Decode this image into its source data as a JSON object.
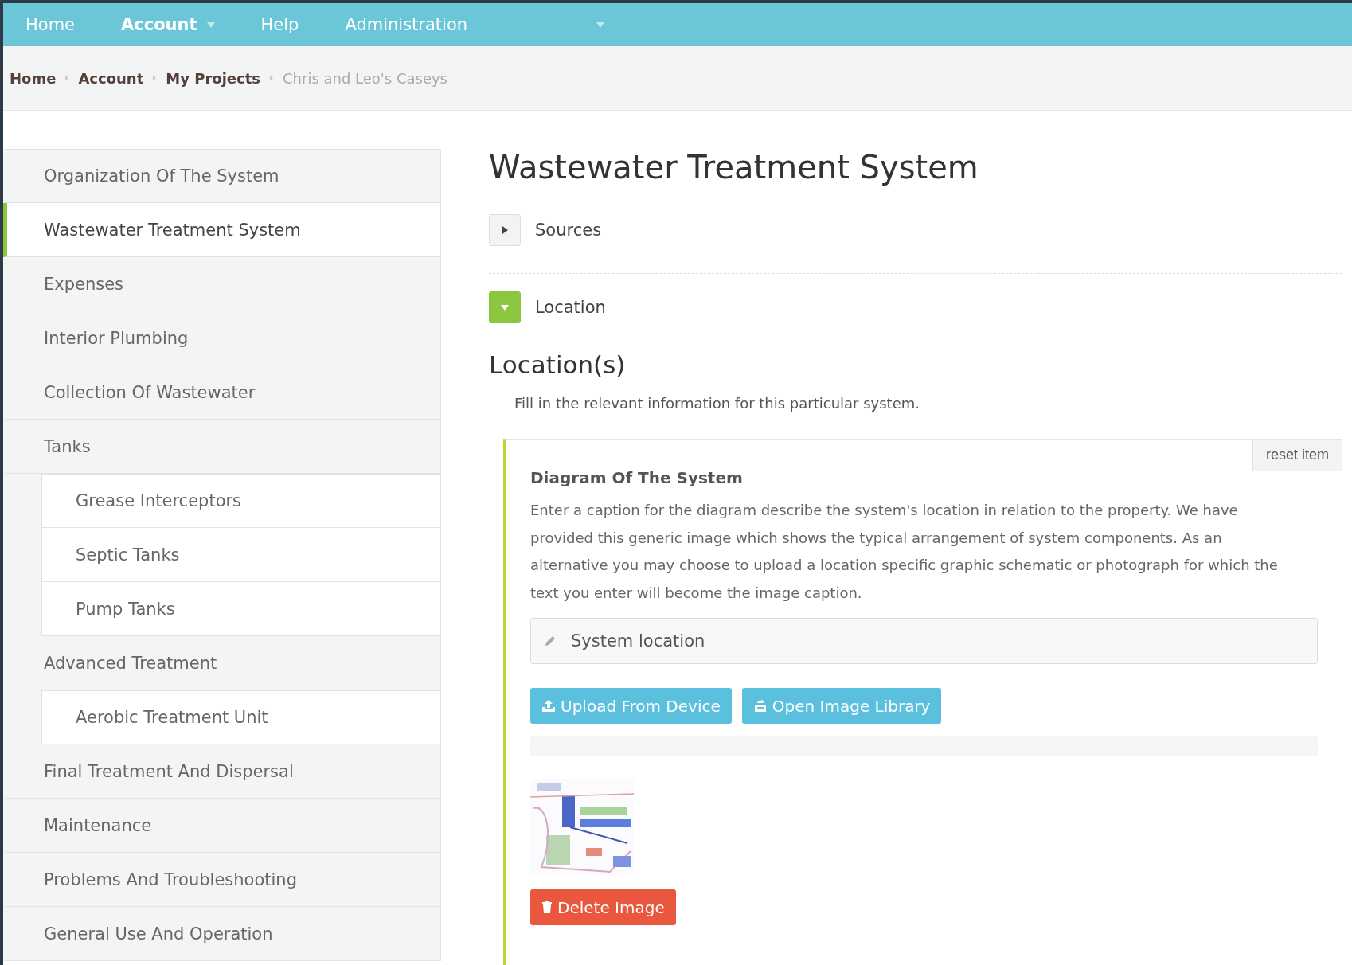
{
  "nav": [
    {
      "label": "Home",
      "selected": false,
      "dropdown": false
    },
    {
      "label": "Account",
      "selected": true,
      "dropdown": true
    },
    {
      "label": "Help",
      "selected": false,
      "dropdown": false
    },
    {
      "label": "Administration",
      "selected": false,
      "dropdown": true
    }
  ],
  "breadcrumb": [
    {
      "label": "Home",
      "current": false
    },
    {
      "label": "Account",
      "current": false
    },
    {
      "label": "My Projects",
      "current": false
    },
    {
      "label": "Chris and Leo's Caseys",
      "current": true
    }
  ],
  "sidebar": {
    "items": [
      {
        "label": "Organization Of The System",
        "selected": false
      },
      {
        "label": "Wastewater Treatment System",
        "selected": true
      },
      {
        "label": "Expenses",
        "selected": false
      },
      {
        "label": "Interior Plumbing",
        "selected": false
      },
      {
        "label": "Collection Of Wastewater",
        "selected": false
      },
      {
        "label": "Tanks",
        "selected": false,
        "children": [
          {
            "label": "Grease Interceptors",
            "selected": false
          },
          {
            "label": "Septic Tanks",
            "selected": false
          },
          {
            "label": "Pump Tanks",
            "selected": false
          }
        ]
      },
      {
        "label": "Advanced Treatment",
        "selected": false,
        "children": [
          {
            "label": "Aerobic Treatment Unit",
            "selected": false
          }
        ]
      },
      {
        "label": "Final Treatment And Dispersal",
        "selected": false
      },
      {
        "label": "Maintenance",
        "selected": false
      },
      {
        "label": "Problems And Troubleshooting",
        "selected": false
      },
      {
        "label": "General Use And Operation",
        "selected": false
      }
    ]
  },
  "page_title": "Wastewater Treatment System",
  "sections": [
    {
      "label": "Sources",
      "expanded": false
    },
    {
      "label": "Location",
      "expanded": true
    }
  ],
  "location": {
    "heading": "Location(s)",
    "intro": "Fill in the relevant information for this particular system.",
    "item": {
      "reset": "reset item",
      "title": "Diagram Of The System",
      "description": "Enter a caption for the diagram describe the system's location in relation to the property. We have provided this generic image which shows the typical arrangement of system components. As an alternative you may choose to upload a location specific graphic schematic or photograph for which the text you enter will become the image caption.",
      "caption_field": {
        "value": "System location"
      },
      "buttons": [
        {
          "label": "Upload From Device",
          "kind": "upload"
        },
        {
          "label": "Open Image Library",
          "kind": "library"
        }
      ],
      "upload_progress": {
        "level": 0
      },
      "delete_button": "Delete Image"
    }
  }
}
